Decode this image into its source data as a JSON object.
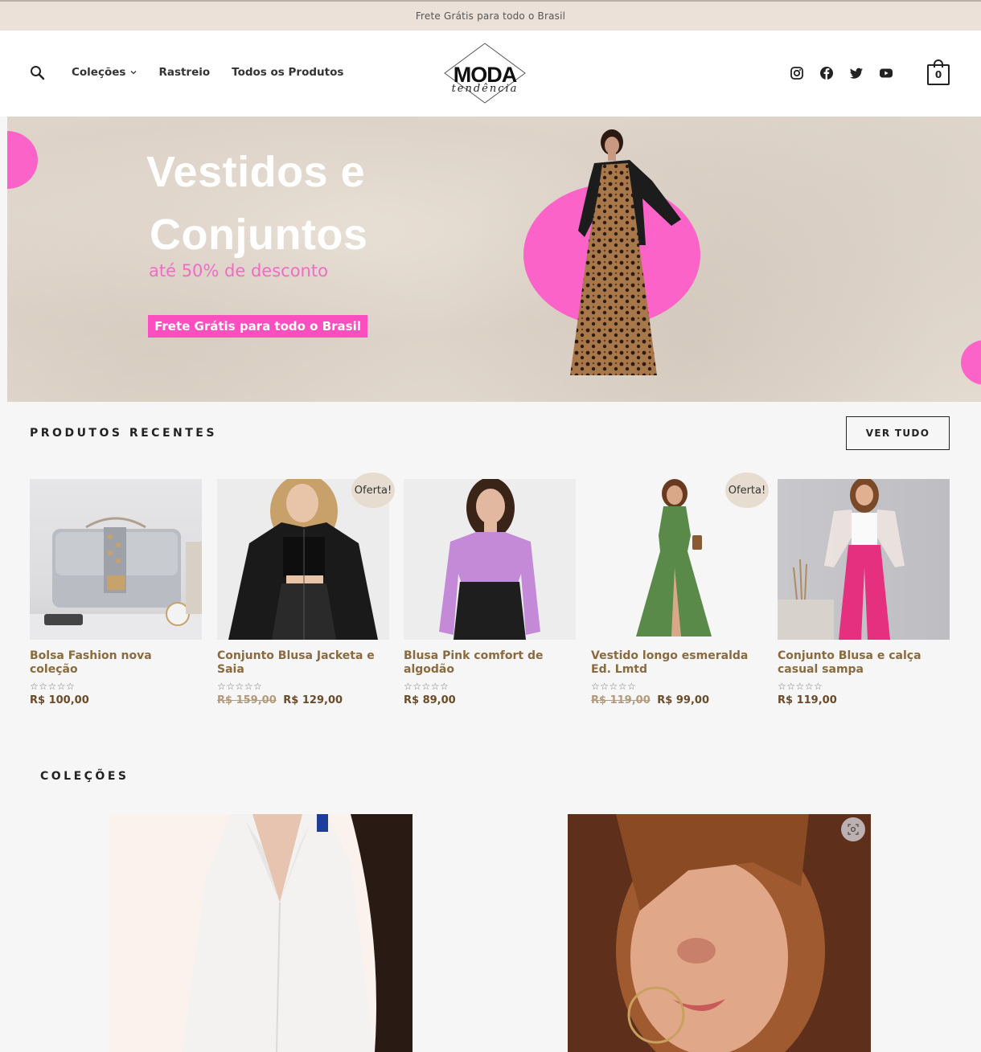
{
  "announcement": "Frete Grátis para todo o Brasil",
  "header": {
    "nav": [
      {
        "label": "Coleções",
        "has_dropdown": true
      },
      {
        "label": "Rastreio"
      },
      {
        "label": "Todos os Produtos"
      }
    ],
    "logo": {
      "primary": "MODA",
      "script": "tendência"
    },
    "social": [
      "instagram-icon",
      "facebook-icon",
      "twitter-icon",
      "youtube-icon"
    ],
    "cart_count": "0"
  },
  "hero": {
    "title_line1": "Vestidos e",
    "title_line2": "Conjuntos",
    "subtitle": "até 50% de desconto",
    "cta": "Frete Grátis para todo o Brasil",
    "accent": "#fb63c8"
  },
  "recent": {
    "title": "PRODUTOS RECENTES",
    "view_all": "VER TUDO",
    "sale_badge": "Oferta!",
    "products": [
      {
        "name": "Bolsa Fashion nova coleção",
        "price": "R$ 100,00",
        "old_price": "",
        "sale": false
      },
      {
        "name": "Conjunto Blusa Jacketa e Saia",
        "price": "R$ 129,00",
        "old_price": "R$ 159,00",
        "sale": true
      },
      {
        "name": "Blusa Pink comfort de algodão",
        "price": "R$ 89,00",
        "old_price": "",
        "sale": false
      },
      {
        "name": "Vestido longo esmeralda Ed. Lmtd",
        "price": "R$ 99,00",
        "old_price": "R$ 119,00",
        "sale": true
      },
      {
        "name": "Conjunto Blusa e calça casual sampa",
        "price": "R$ 119,00",
        "old_price": "",
        "sale": false
      }
    ]
  },
  "collections": {
    "title": "COLEÇÕES"
  }
}
